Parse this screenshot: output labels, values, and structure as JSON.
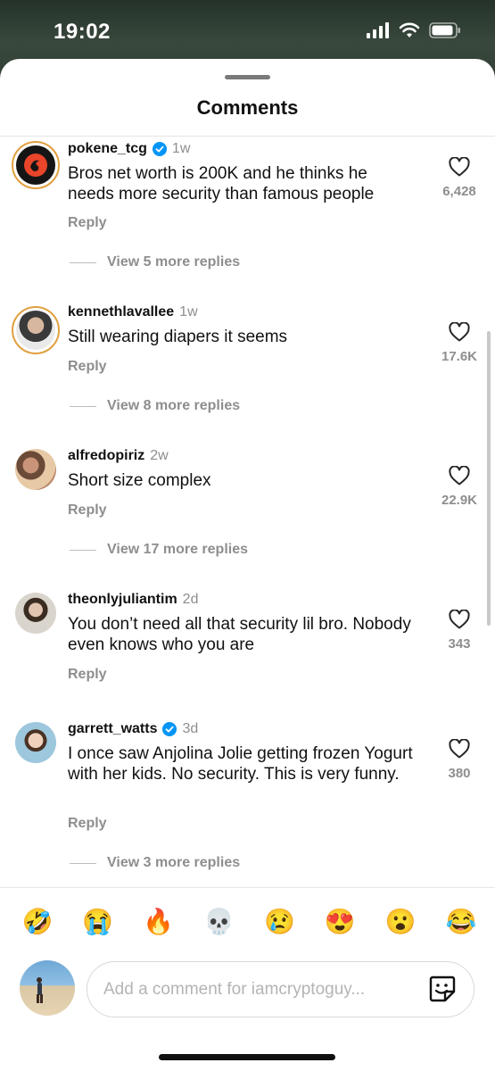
{
  "status_bar": {
    "time": "19:02"
  },
  "sheet": {
    "title": "Comments"
  },
  "comments": [
    {
      "username": "pokene_tcg",
      "verified": true,
      "ago": "1w",
      "text": "Bros net worth is 200K and he thinks he needs more security than famous people",
      "reply_label": "Reply",
      "likes": "6,428",
      "more_replies": "View 5 more replies"
    },
    {
      "username": "kennethlavallee",
      "verified": false,
      "ago": "1w",
      "text": "Still wearing diapers it seems",
      "reply_label": "Reply",
      "likes": "17.6K",
      "more_replies": "View 8 more replies"
    },
    {
      "username": "alfredopiriz",
      "verified": false,
      "ago": "2w",
      "text": "Short size complex",
      "reply_label": "Reply",
      "likes": "22.9K",
      "more_replies": "View 17 more replies"
    },
    {
      "username": "theonlyjuliantim",
      "verified": false,
      "ago": "2d",
      "text": "You don’t need all that security lil bro. Nobody even knows who you are",
      "reply_label": "Reply",
      "likes": "343"
    },
    {
      "username": "garrett_watts",
      "verified": true,
      "ago": "3d",
      "text": "I once saw Anjolina Jolie getting frozen Yogurt with her kids. No security. This is very funny.",
      "reply_label": "Reply",
      "likes": "380",
      "more_replies": "View 3 more replies"
    }
  ],
  "emoji_bar": [
    "🤣",
    "😭",
    "🔥",
    "💀",
    "😢",
    "😍",
    "😮",
    "😂"
  ],
  "composer": {
    "placeholder": "Add a comment for iamcryptoguy..."
  },
  "icons": {
    "like": "heart-outline-icon",
    "verified": "verified-badge-icon",
    "sticker": "sticker-icon"
  },
  "colors": {
    "verified": "#0095f6",
    "muted": "#8e8e8e"
  }
}
